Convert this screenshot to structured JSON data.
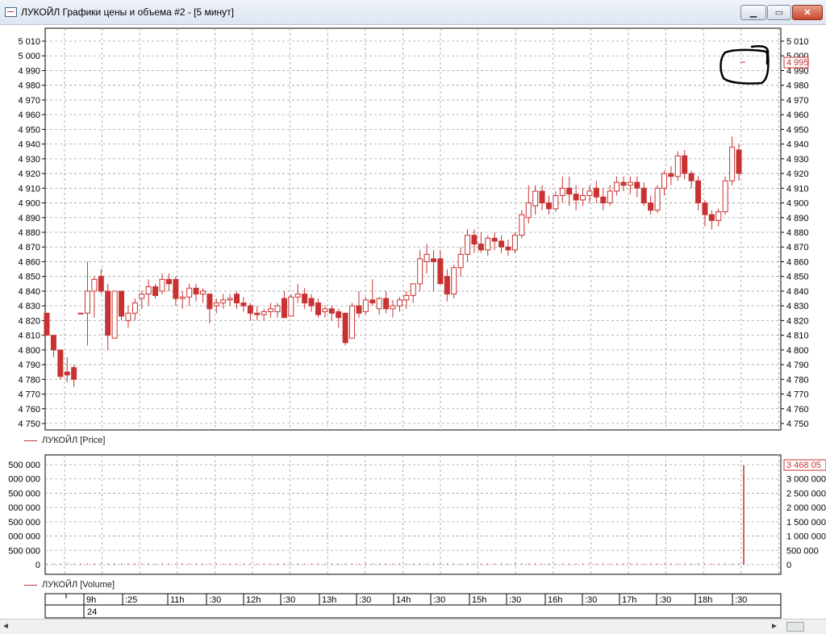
{
  "window": {
    "title": "ЛУКОЙЛ Графики цены и объема #2 - [5 минут]",
    "minimize_glyph": "▁",
    "maximize_glyph": "▭",
    "close_glyph": "✕"
  },
  "colors": {
    "candle": "#c83232",
    "grid": "#a0a0a0",
    "annotation": "#000000"
  },
  "price_legend": "ЛУКОЙЛ [Price]",
  "volume_legend": "ЛУКОЙЛ [Volume]",
  "price_tag": "4 995",
  "volume_tag": "3 468 05",
  "price_axis": {
    "min": 4750,
    "max": 5010,
    "step": 10,
    "left_labels": [
      "4 750",
      "4 760",
      "4 770",
      "4 780",
      "4 790",
      "4 800",
      "4 810",
      "4 820",
      "4 830",
      "4 840",
      "4 850",
      "4 860",
      "4 870",
      "4 880",
      "4 890",
      "4 900",
      "4 910",
      "4 920",
      "4 930",
      "4 940",
      "4 950",
      "4 960",
      "4 970",
      "4 980",
      "4 990",
      "5 000",
      "5 010"
    ],
    "right_labels": [
      "4 750",
      "4 760",
      "4 770",
      "4 780",
      "4 790",
      "4 800",
      "4 810",
      "4 820",
      "4 830",
      "4 840",
      "4 850",
      "4 860",
      "4 870",
      "4 880",
      "4 890",
      "4 900",
      "4 910",
      "4 920",
      "4 930",
      "4 940",
      "4 950",
      "4 960",
      "4 970",
      "4 980",
      "4 990",
      "5 000",
      "5 010"
    ]
  },
  "volume_axis": {
    "min": 0,
    "max": 3500000,
    "step": 500000,
    "left_labels": [
      "0",
      "500 000",
      "000 000",
      "500 000",
      "000 000",
      "500 000",
      "000 000",
      "500 000"
    ],
    "right_labels": [
      "0",
      "500 000",
      "1 000 000",
      "1 500 000",
      "2 000 000",
      "2 500 000",
      "3 000 000"
    ]
  },
  "time_axis": {
    "labels": [
      "9h",
      ":25",
      "11h",
      ":30",
      "12h",
      ":30",
      "13h",
      ":30",
      "14h",
      ":30",
      "15h",
      ":30",
      "16h",
      ":30",
      "17h",
      ":30",
      "18h",
      ":30"
    ],
    "date": "24"
  },
  "scrollbar": {
    "left_arrow": "◄",
    "right_arrow": "►"
  },
  "chart_data": {
    "type": "candlestick",
    "price_min": 4750,
    "price_max": 5010,
    "candles": [
      {
        "o": 4825,
        "h": 4825,
        "l": 4810,
        "c": 4810
      },
      {
        "o": 4810,
        "h": 4810,
        "l": 4795,
        "c": 4800
      },
      {
        "o": 4800,
        "h": 4800,
        "l": 4780,
        "c": 4782
      },
      {
        "o": 4785,
        "h": 4795,
        "l": 4778,
        "c": 4783
      },
      {
        "o": 4788,
        "h": 4790,
        "l": 4775,
        "c": 4780
      },
      {
        "o": 4825,
        "h": 4825,
        "l": 4825,
        "c": 4825
      },
      {
        "o": 4825,
        "h": 4860,
        "l": 4803,
        "c": 4840
      },
      {
        "o": 4840,
        "h": 4850,
        "l": 4822,
        "c": 4848
      },
      {
        "o": 4850,
        "h": 4855,
        "l": 4838,
        "c": 4840
      },
      {
        "o": 4840,
        "h": 4845,
        "l": 4800,
        "c": 4810
      },
      {
        "o": 4808,
        "h": 4840,
        "l": 4808,
        "c": 4840
      },
      {
        "o": 4840,
        "h": 4840,
        "l": 4820,
        "c": 4823
      },
      {
        "o": 4820,
        "h": 4830,
        "l": 4815,
        "c": 4825
      },
      {
        "o": 4825,
        "h": 4835,
        "l": 4820,
        "c": 4832
      },
      {
        "o": 4835,
        "h": 4840,
        "l": 4828,
        "c": 4838
      },
      {
        "o": 4838,
        "h": 4848,
        "l": 4830,
        "c": 4843
      },
      {
        "o": 4843,
        "h": 4845,
        "l": 4835,
        "c": 4837
      },
      {
        "o": 4840,
        "h": 4852,
        "l": 4838,
        "c": 4848
      },
      {
        "o": 4848,
        "h": 4852,
        "l": 4840,
        "c": 4845
      },
      {
        "o": 4848,
        "h": 4850,
        "l": 4830,
        "c": 4835
      },
      {
        "o": 4835,
        "h": 4840,
        "l": 4828,
        "c": 4836
      },
      {
        "o": 4836,
        "h": 4845,
        "l": 4830,
        "c": 4842
      },
      {
        "o": 4842,
        "h": 4845,
        "l": 4833,
        "c": 4838
      },
      {
        "o": 4838,
        "h": 4842,
        "l": 4832,
        "c": 4840
      },
      {
        "o": 4838,
        "h": 4838,
        "l": 4818,
        "c": 4828
      },
      {
        "o": 4830,
        "h": 4835,
        "l": 4825,
        "c": 4832
      },
      {
        "o": 4832,
        "h": 4838,
        "l": 4828,
        "c": 4834
      },
      {
        "o": 4834,
        "h": 4838,
        "l": 4830,
        "c": 4835
      },
      {
        "o": 4838,
        "h": 4840,
        "l": 4828,
        "c": 4832
      },
      {
        "o": 4832,
        "h": 4836,
        "l": 4826,
        "c": 4830
      },
      {
        "o": 4830,
        "h": 4832,
        "l": 4820,
        "c": 4825
      },
      {
        "o": 4825,
        "h": 4830,
        "l": 4820,
        "c": 4824
      },
      {
        "o": 4824,
        "h": 4828,
        "l": 4820,
        "c": 4826
      },
      {
        "o": 4826,
        "h": 4832,
        "l": 4822,
        "c": 4828
      },
      {
        "o": 4826,
        "h": 4832,
        "l": 4822,
        "c": 4830
      },
      {
        "o": 4835,
        "h": 4840,
        "l": 4825,
        "c": 4822
      },
      {
        "o": 4823,
        "h": 4838,
        "l": 4823,
        "c": 4836
      },
      {
        "o": 4836,
        "h": 4845,
        "l": 4832,
        "c": 4838
      },
      {
        "o": 4838,
        "h": 4842,
        "l": 4828,
        "c": 4832
      },
      {
        "o": 4835,
        "h": 4838,
        "l": 4826,
        "c": 4830
      },
      {
        "o": 4832,
        "h": 4835,
        "l": 4822,
        "c": 4824
      },
      {
        "o": 4826,
        "h": 4830,
        "l": 4822,
        "c": 4828
      },
      {
        "o": 4828,
        "h": 4830,
        "l": 4820,
        "c": 4825
      },
      {
        "o": 4826,
        "h": 4828,
        "l": 4815,
        "c": 4822
      },
      {
        "o": 4825,
        "h": 4825,
        "l": 4803,
        "c": 4805
      },
      {
        "o": 4808,
        "h": 4832,
        "l": 4808,
        "c": 4830
      },
      {
        "o": 4830,
        "h": 4840,
        "l": 4822,
        "c": 4825
      },
      {
        "o": 4826,
        "h": 4836,
        "l": 4824,
        "c": 4834
      },
      {
        "o": 4834,
        "h": 4848,
        "l": 4830,
        "c": 4832
      },
      {
        "o": 4828,
        "h": 4836,
        "l": 4824,
        "c": 4835
      },
      {
        "o": 4835,
        "h": 4840,
        "l": 4825,
        "c": 4828
      },
      {
        "o": 4828,
        "h": 4834,
        "l": 4822,
        "c": 4830
      },
      {
        "o": 4830,
        "h": 4836,
        "l": 4826,
        "c": 4834
      },
      {
        "o": 4834,
        "h": 4840,
        "l": 4828,
        "c": 4837
      },
      {
        "o": 4837,
        "h": 4845,
        "l": 4832,
        "c": 4845
      },
      {
        "o": 4845,
        "h": 4868,
        "l": 4840,
        "c": 4862
      },
      {
        "o": 4860,
        "h": 4872,
        "l": 4852,
        "c": 4865
      },
      {
        "o": 4862,
        "h": 4868,
        "l": 4840,
        "c": 4860
      },
      {
        "o": 4862,
        "h": 4868,
        "l": 4845,
        "c": 4845
      },
      {
        "o": 4850,
        "h": 4855,
        "l": 4833,
        "c": 4838
      },
      {
        "o": 4838,
        "h": 4858,
        "l": 4835,
        "c": 4856
      },
      {
        "o": 4856,
        "h": 4870,
        "l": 4850,
        "c": 4865
      },
      {
        "o": 4865,
        "h": 4882,
        "l": 4860,
        "c": 4878
      },
      {
        "o": 4878,
        "h": 4882,
        "l": 4866,
        "c": 4872
      },
      {
        "o": 4872,
        "h": 4880,
        "l": 4866,
        "c": 4868
      },
      {
        "o": 4868,
        "h": 4878,
        "l": 4864,
        "c": 4876
      },
      {
        "o": 4876,
        "h": 4880,
        "l": 4868,
        "c": 4874
      },
      {
        "o": 4874,
        "h": 4878,
        "l": 4866,
        "c": 4870
      },
      {
        "o": 4870,
        "h": 4875,
        "l": 4864,
        "c": 4868
      },
      {
        "o": 4868,
        "h": 4880,
        "l": 4866,
        "c": 4878
      },
      {
        "o": 4878,
        "h": 4895,
        "l": 4876,
        "c": 4892
      },
      {
        "o": 4890,
        "h": 4912,
        "l": 4886,
        "c": 4900
      },
      {
        "o": 4898,
        "h": 4912,
        "l": 4892,
        "c": 4908
      },
      {
        "o": 4908,
        "h": 4912,
        "l": 4895,
        "c": 4900
      },
      {
        "o": 4900,
        "h": 4905,
        "l": 4892,
        "c": 4896
      },
      {
        "o": 4896,
        "h": 4908,
        "l": 4894,
        "c": 4905
      },
      {
        "o": 4905,
        "h": 4918,
        "l": 4900,
        "c": 4910
      },
      {
        "o": 4910,
        "h": 4918,
        "l": 4898,
        "c": 4906
      },
      {
        "o": 4906,
        "h": 4912,
        "l": 4895,
        "c": 4902
      },
      {
        "o": 4902,
        "h": 4910,
        "l": 4898,
        "c": 4905
      },
      {
        "o": 4905,
        "h": 4912,
        "l": 4900,
        "c": 4908
      },
      {
        "o": 4910,
        "h": 4915,
        "l": 4900,
        "c": 4904
      },
      {
        "o": 4904,
        "h": 4910,
        "l": 4895,
        "c": 4900
      },
      {
        "o": 4900,
        "h": 4912,
        "l": 4898,
        "c": 4908
      },
      {
        "o": 4908,
        "h": 4918,
        "l": 4905,
        "c": 4914
      },
      {
        "o": 4914,
        "h": 4918,
        "l": 4908,
        "c": 4912
      },
      {
        "o": 4912,
        "h": 4918,
        "l": 4906,
        "c": 4914
      },
      {
        "o": 4914,
        "h": 4918,
        "l": 4904,
        "c": 4910
      },
      {
        "o": 4910,
        "h": 4914,
        "l": 4898,
        "c": 4900
      },
      {
        "o": 4900,
        "h": 4905,
        "l": 4892,
        "c": 4895
      },
      {
        "o": 4895,
        "h": 4912,
        "l": 4893,
        "c": 4910
      },
      {
        "o": 4910,
        "h": 4922,
        "l": 4905,
        "c": 4920
      },
      {
        "o": 4920,
        "h": 4925,
        "l": 4912,
        "c": 4918
      },
      {
        "o": 4918,
        "h": 4935,
        "l": 4915,
        "c": 4932
      },
      {
        "o": 4932,
        "h": 4936,
        "l": 4916,
        "c": 4920
      },
      {
        "o": 4920,
        "h": 4922,
        "l": 4910,
        "c": 4915
      },
      {
        "o": 4915,
        "h": 4918,
        "l": 4895,
        "c": 4900
      },
      {
        "o": 4900,
        "h": 4902,
        "l": 4884,
        "c": 4892
      },
      {
        "o": 4892,
        "h": 4895,
        "l": 4882,
        "c": 4888
      },
      {
        "o": 4888,
        "h": 4896,
        "l": 4884,
        "c": 4894
      },
      {
        "o": 4894,
        "h": 4918,
        "l": 4892,
        "c": 4915
      },
      {
        "o": 4915,
        "h": 4945,
        "l": 4912,
        "c": 4938
      },
      {
        "o": 4936,
        "h": 4940,
        "l": 4915,
        "c": 4920
      }
    ],
    "volume": {
      "spike_value": 3468050
    }
  }
}
